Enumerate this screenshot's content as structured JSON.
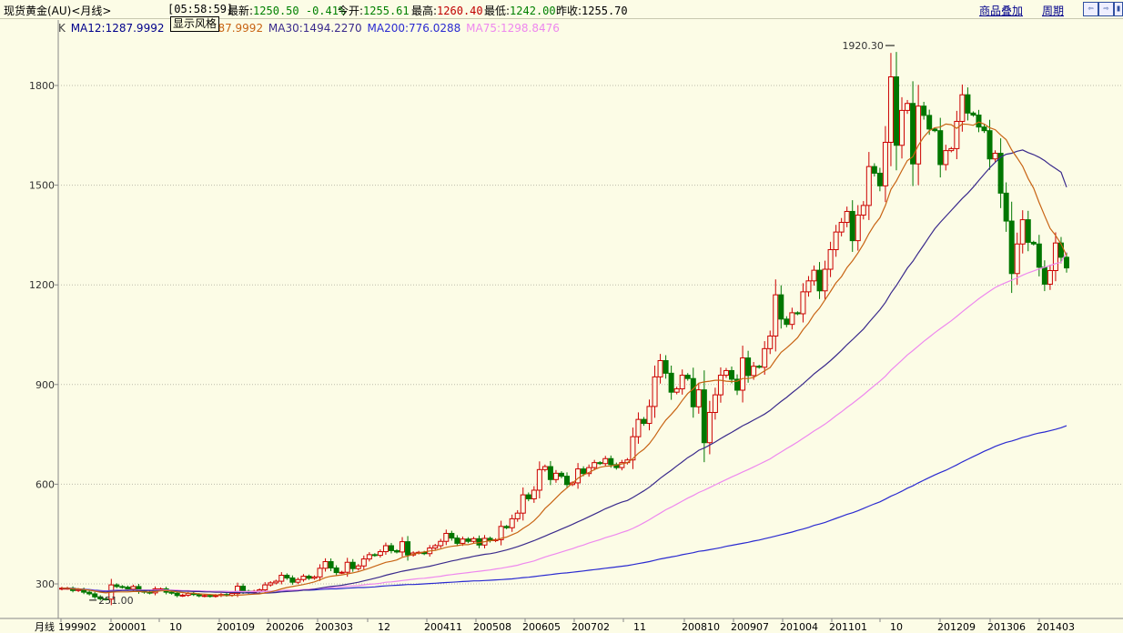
{
  "header": {
    "symbol": "现货黄金(AU)",
    "period": "<月线>",
    "time": "05:58:59",
    "latest_label": "最新:",
    "latest": "1250.50",
    "change": "-0.41%",
    "open_label": "今开:",
    "open": "1255.61",
    "high_label": "最高:",
    "high": "1260.40",
    "low_label": "最低:",
    "low": "1242.00",
    "prev_label": "昨收:",
    "prev": "1255.70",
    "overlay_link": "商品叠加",
    "period_link": "周期"
  },
  "tooltip": "显示风格",
  "legend": {
    "k": "K",
    "ma12": "MA12:1287.9992",
    "ma26": "MA26:1287.9992",
    "ma30": "MA30:1494.2270",
    "ma200": "MA200:776.0288",
    "ma75": "MA75:1298.8476"
  },
  "colors": {
    "up": "#cc0000",
    "down": "#007700",
    "ma12": "#c86414",
    "ma30": "#3a2a8c",
    "ma75": "#ee88ee",
    "ma200": "#2a2ad0",
    "grid": "#bbbbaa"
  },
  "chart_data": {
    "type": "candlestick",
    "period": "月线",
    "ylim": [
      200,
      1950
    ],
    "yticks": [
      300,
      600,
      900,
      1200,
      1500,
      1800
    ],
    "annotations": [
      {
        "text": "1920.30",
        "date": "2011-09",
        "value": 1920.3
      },
      {
        "text": "251.00",
        "date": "1999-07",
        "value": 251.0
      }
    ],
    "x_labels": [
      "199902",
      "200001",
      "10",
      "200109",
      "200206",
      "200303",
      "12",
      "200411",
      "200508",
      "200605",
      "200702",
      "11",
      "200810",
      "200907",
      "201004",
      "201101",
      "10",
      "201209",
      "201306",
      "201403"
    ],
    "closes": [
      287,
      287,
      280,
      283,
      275,
      270,
      261,
      255,
      254,
      297,
      292,
      290,
      284,
      292,
      278,
      275,
      273,
      285,
      285,
      275,
      272,
      265,
      266,
      271,
      268,
      264,
      265,
      263,
      265,
      268,
      266,
      271,
      293,
      278,
      274,
      278,
      282,
      297,
      303,
      308,
      326,
      318,
      305,
      313,
      323,
      317,
      321,
      347,
      367,
      348,
      334,
      335,
      365,
      346,
      354,
      375,
      388,
      386,
      397,
      415,
      400,
      396,
      427,
      387,
      393,
      395,
      391,
      408,
      415,
      428,
      452,
      438,
      422,
      435,
      428,
      436,
      417,
      437,
      430,
      433,
      473,
      469,
      496,
      513,
      568,
      556,
      582,
      644,
      653,
      614,
      633,
      624,
      599,
      604,
      646,
      632,
      650,
      665,
      662,
      677,
      659,
      650,
      665,
      673,
      743,
      795,
      783,
      834,
      923,
      972,
      934,
      877,
      887,
      928,
      918,
      833,
      884,
      725,
      816,
      869,
      928,
      942,
      916,
      883,
      980,
      927,
      955,
      952,
      1008,
      1046,
      1170,
      1097,
      1081,
      1116,
      1113,
      1179,
      1212,
      1244,
      1182,
      1247,
      1306,
      1359,
      1388,
      1421,
      1333,
      1410,
      1439,
      1556,
      1536,
      1498,
      1629,
      1826,
      1620,
      1725,
      1746,
      1564,
      1738,
      1710,
      1669,
      1664,
      1562,
      1604,
      1610,
      1692,
      1772,
      1717,
      1711,
      1675,
      1664,
      1579,
      1596,
      1476,
      1392,
      1234,
      1323,
      1396,
      1328,
      1323,
      1253,
      1202,
      1243,
      1326,
      1283,
      1251
    ],
    "ma12": [
      287,
      287,
      285,
      285,
      283,
      281,
      278,
      275,
      273,
      275,
      276,
      276,
      276,
      277,
      277,
      276,
      276,
      277,
      279,
      280,
      278,
      276,
      274,
      272,
      272,
      270,
      269,
      268,
      267,
      266,
      265,
      265,
      266,
      267,
      268,
      269,
      270,
      273,
      276,
      280,
      285,
      289,
      292,
      295,
      298,
      302,
      306,
      312,
      319,
      323,
      325,
      327,
      330,
      333,
      337,
      342,
      347,
      353,
      359,
      365,
      368,
      372,
      380,
      384,
      389,
      393,
      396,
      399,
      401,
      405,
      410,
      413,
      415,
      418,
      418,
      422,
      424,
      427,
      430,
      432,
      437,
      441,
      448,
      455,
      467,
      477,
      490,
      507,
      527,
      542,
      559,
      575,
      589,
      603,
      618,
      628,
      635,
      644,
      651,
      654,
      655,
      658,
      661,
      665,
      677,
      693,
      705,
      722,
      744,
      770,
      793,
      810,
      829,
      852,
      873,
      887,
      904,
      908,
      910,
      913,
      913,
      910,
      909,
      910,
      918,
      918,
      921,
      931,
      941,
      951,
      975,
      997,
      1010,
      1025,
      1041,
      1065,
      1085,
      1111,
      1130,
      1155,
      1180,
      1206,
      1225,
      1252,
      1272,
      1296,
      1323,
      1354,
      1381,
      1402,
      1439,
      1487,
      1513,
      1544,
      1574,
      1586,
      1620,
      1645,
      1664,
      1673,
      1675,
      1684,
      1682,
      1671,
      1684,
      1683,
      1680,
      1690,
      1684,
      1673,
      1667,
      1651,
      1637,
      1606,
      1582,
      1557,
      1520,
      1491,
      1448,
      1408,
      1370,
      1349,
      1323,
      1288
    ],
    "ma30": [
      287,
      287,
      285,
      284,
      283,
      281,
      279,
      277,
      276,
      278,
      279,
      280,
      280,
      281,
      280,
      280,
      280,
      280,
      280,
      280,
      280,
      279,
      278,
      278,
      277,
      277,
      276,
      276,
      275,
      275,
      274,
      274,
      274,
      273,
      273,
      272,
      272,
      272,
      273,
      274,
      276,
      277,
      278,
      279,
      281,
      282,
      284,
      287,
      290,
      292,
      294,
      296,
      299,
      302,
      305,
      309,
      313,
      317,
      321,
      326,
      330,
      334,
      338,
      341,
      344,
      347,
      350,
      353,
      357,
      361,
      365,
      369,
      372,
      376,
      379,
      383,
      386,
      389,
      391,
      394,
      398,
      402,
      407,
      412,
      418,
      424,
      430,
      437,
      444,
      451,
      458,
      465,
      472,
      479,
      487,
      494,
      502,
      510,
      518,
      526,
      533,
      540,
      546,
      551,
      560,
      570,
      580,
      591,
      604,
      618,
      630,
      642,
      655,
      667,
      680,
      690,
      702,
      709,
      718,
      727,
      737,
      747,
      756,
      766,
      776,
      784,
      793,
      802,
      811,
      822,
      836,
      849,
      861,
      875,
      888,
      902,
      917,
      932,
      945,
      958,
      972,
      987,
      1003,
      1020,
      1035,
      1051,
      1067,
      1087,
      1106,
      1125,
      1147,
      1175,
      1198,
      1224,
      1250,
      1271,
      1296,
      1320,
      1345,
      1369,
      1388,
      1406,
      1424,
      1442,
      1460,
      1476,
      1494,
      1514,
      1533,
      1552,
      1569,
      1584,
      1593,
      1596,
      1602,
      1606,
      1598,
      1592,
      1584,
      1574,
      1561,
      1550,
      1539,
      1494
    ],
    "ma75": [
      287,
      287,
      285,
      285,
      283,
      282,
      280,
      278,
      277,
      279,
      280,
      281,
      281,
      282,
      282,
      281,
      281,
      282,
      282,
      282,
      281,
      281,
      280,
      280,
      279,
      279,
      278,
      278,
      277,
      277,
      277,
      277,
      277,
      277,
      277,
      277,
      277,
      277,
      278,
      279,
      280,
      281,
      281,
      282,
      283,
      284,
      285,
      286,
      288,
      289,
      290,
      291,
      293,
      294,
      295,
      297,
      299,
      300,
      302,
      305,
      306,
      308,
      310,
      312,
      314,
      316,
      317,
      319,
      321,
      323,
      326,
      328,
      330,
      332,
      334,
      336,
      338,
      340,
      342,
      345,
      347,
      350,
      353,
      356,
      361,
      365,
      369,
      375,
      381,
      386,
      391,
      396,
      401,
      406,
      412,
      417,
      423,
      428,
      433,
      439,
      444,
      449,
      455,
      460,
      467,
      475,
      484,
      493,
      503,
      513,
      523,
      531,
      540,
      549,
      558,
      566,
      575,
      582,
      590,
      598,
      606,
      614,
      622,
      629,
      637,
      644,
      652,
      660,
      668,
      676,
      687,
      697,
      707,
      717,
      727,
      738,
      749,
      760,
      770,
      781,
      793,
      806,
      818,
      831,
      843,
      856,
      869,
      883,
      897,
      910,
      925,
      943,
      958,
      973,
      989,
      1002,
      1016,
      1030,
      1043,
      1056,
      1068,
      1080,
      1092,
      1105,
      1119,
      1132,
      1145,
      1158,
      1170,
      1181,
      1192,
      1200,
      1207,
      1214,
      1221,
      1229,
      1236,
      1242,
      1248,
      1253,
      1258,
      1264,
      1268,
      1299
    ],
    "ma200": [
      287,
      287,
      286,
      285,
      284,
      283,
      281,
      280,
      279,
      280,
      281,
      281,
      281,
      282,
      281,
      281,
      281,
      281,
      281,
      281,
      280,
      280,
      279,
      279,
      279,
      278,
      278,
      277,
      277,
      277,
      277,
      276,
      277,
      277,
      276,
      276,
      277,
      277,
      277,
      278,
      279,
      279,
      280,
      280,
      281,
      281,
      282,
      283,
      284,
      285,
      285,
      286,
      287,
      288,
      289,
      289,
      290,
      291,
      293,
      294,
      295,
      296,
      297,
      298,
      298,
      299,
      300,
      301,
      302,
      303,
      304,
      305,
      306,
      307,
      308,
      309,
      309,
      310,
      311,
      312,
      313,
      314,
      315,
      317,
      319,
      320,
      322,
      324,
      326,
      328,
      330,
      332,
      333,
      335,
      337,
      339,
      341,
      343,
      345,
      347,
      349,
      351,
      353,
      355,
      358,
      361,
      364,
      367,
      371,
      375,
      378,
      381,
      384,
      388,
      391,
      394,
      398,
      400,
      403,
      406,
      409,
      413,
      416,
      419,
      422,
      425,
      429,
      432,
      436,
      440,
      444,
      448,
      452,
      456,
      461,
      465,
      470,
      476,
      480,
      485,
      491,
      497,
      503,
      509,
      514,
      520,
      527,
      534,
      541,
      547,
      555,
      564,
      571,
      579,
      588,
      595,
      604,
      612,
      620,
      628,
      635,
      642,
      650,
      658,
      667,
      675,
      683,
      691,
      699,
      706,
      714,
      720,
      726,
      730,
      735,
      741,
      745,
      750,
      754,
      757,
      761,
      765,
      770,
      776
    ]
  }
}
